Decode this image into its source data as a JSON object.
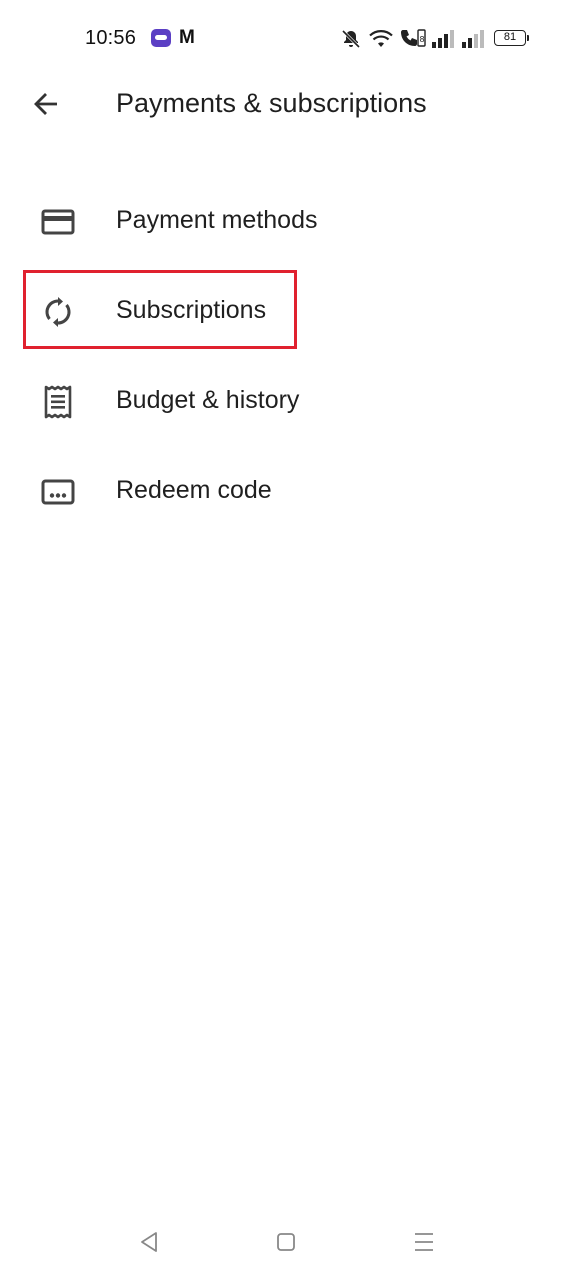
{
  "status_bar": {
    "time": "10:56",
    "battery_level": "81",
    "icons": [
      "app-notification-icon",
      "m-notification-icon",
      "bell-off-icon",
      "wifi-icon",
      "volte-call-icon",
      "signal-icon",
      "signal-icon",
      "battery-icon"
    ]
  },
  "app_bar": {
    "back_icon": "arrow-left-icon",
    "title": "Payments & subscriptions"
  },
  "menu": {
    "items": [
      {
        "label": "Payment methods",
        "icon": "credit-card-icon"
      },
      {
        "label": "Subscriptions",
        "icon": "sync-icon",
        "highlighted": true
      },
      {
        "label": "Budget & history",
        "icon": "receipt-icon"
      },
      {
        "label": "Redeem code",
        "icon": "redeem-code-icon"
      }
    ]
  },
  "nav_bar": {
    "buttons": [
      "back-triangle-icon",
      "home-square-icon",
      "recents-menu-icon"
    ]
  },
  "colors": {
    "highlight": "#e0212f",
    "icon": "#444444",
    "text": "#1f1f1f"
  }
}
